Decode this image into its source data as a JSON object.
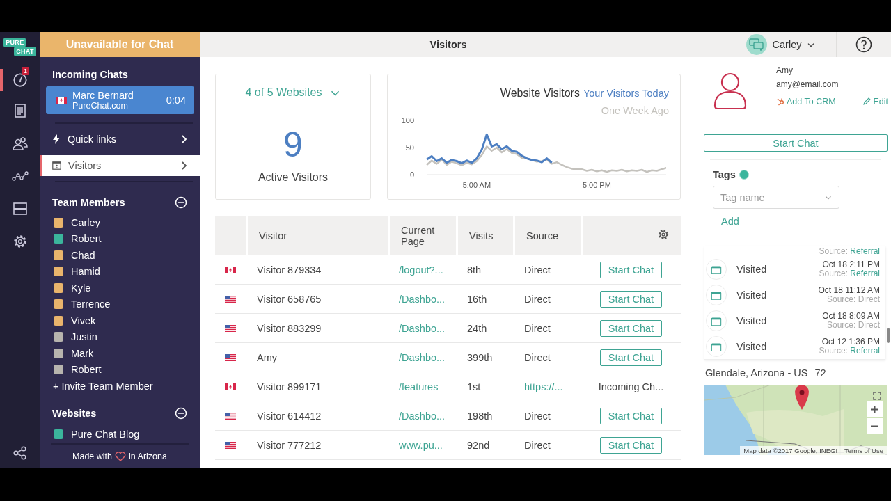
{
  "rail": {
    "logo": [
      "PURE",
      "CHAT"
    ],
    "badge": "1"
  },
  "sidebar": {
    "status": "Unavailable for Chat",
    "incoming_title": "Incoming Chats",
    "chats": [
      {
        "kind": "ca",
        "name": "Marc Bernard",
        "site": "PureChat.com",
        "time": "0:04"
      }
    ],
    "nav": [
      {
        "kind": "bolt",
        "label": "Quick links",
        "selected": false
      },
      {
        "kind": "browser",
        "label": "Visitors",
        "selected": true
      }
    ],
    "team_title": "Team Members",
    "team": [
      {
        "name": "Carley",
        "color": "#e9b46c"
      },
      {
        "name": "Robert",
        "color": "#3bb59c"
      },
      {
        "name": "Chad",
        "color": "#e9b46c"
      },
      {
        "name": "Hamid",
        "color": "#e9b46c"
      },
      {
        "name": "Kyle",
        "color": "#e9b46c"
      },
      {
        "name": "Terrence",
        "color": "#e9b46c"
      },
      {
        "name": "Vivek",
        "color": "#e9b46c"
      },
      {
        "name": "Justin",
        "color": "#b7b4ae"
      },
      {
        "name": "Mark",
        "color": "#b7b4ae"
      },
      {
        "name": "Robert",
        "color": "#b7b4ae"
      }
    ],
    "invite": "+ Invite Team Member",
    "websites_title": "Websites",
    "websites": [
      {
        "name": "Pure Chat Blog",
        "color": "#3bb59c"
      }
    ],
    "footer": [
      "Made with",
      "in Arizona"
    ]
  },
  "topbar": {
    "title": "Visitors",
    "user": "Carley"
  },
  "summary": {
    "websites": "4 of 5 Websites",
    "count": "9",
    "label": "Active Visitors"
  },
  "chart": {
    "chart_data": {
      "type": "line",
      "title": "Website Visitors",
      "x": [
        0,
        0.5,
        1,
        1.5,
        2,
        2.5,
        3,
        3.5,
        4,
        4.5,
        5,
        5.5,
        6,
        6.5,
        7,
        7.5,
        8,
        8.5,
        9,
        9.5,
        10,
        10.5,
        11,
        11.5,
        12,
        12.5,
        13,
        13.5,
        14,
        14.5,
        15,
        15.5,
        16,
        16.5,
        17,
        17.5,
        18,
        18.5,
        19,
        19.5,
        20,
        20.5,
        21,
        21.5,
        22,
        22.5,
        23,
        23.5,
        24
      ],
      "xlim": [
        0,
        24
      ],
      "ylim": [
        0,
        100
      ],
      "yticks": [
        0,
        50,
        100
      ],
      "xticks": [
        {
          "value": 5,
          "label": "5:00 AM"
        },
        {
          "value": 17,
          "label": "5:00 PM"
        }
      ],
      "series": [
        {
          "name": "Your Visitors Today",
          "color": "#4d7fc2",
          "values": [
            28,
            34,
            25,
            30,
            22,
            27,
            25,
            21,
            26,
            22,
            30,
            46,
            74,
            52,
            56,
            47,
            52,
            44,
            42,
            35,
            30,
            27,
            26,
            23,
            30,
            22,
            null,
            null,
            null,
            null,
            null,
            null,
            null,
            null,
            null,
            null,
            null,
            null,
            null,
            null,
            null,
            null,
            null,
            null,
            null,
            null,
            null,
            null,
            null
          ]
        },
        {
          "name": "One Week Ago",
          "color": "#c4c2bd",
          "values": [
            18,
            26,
            20,
            28,
            18,
            24,
            21,
            17,
            22,
            19,
            25,
            36,
            52,
            44,
            50,
            41,
            47,
            40,
            38,
            31,
            30,
            27,
            24,
            25,
            28,
            20,
            23,
            18,
            14,
            11,
            10,
            10,
            7,
            9,
            6,
            8,
            5,
            8,
            7,
            9,
            6,
            8,
            7,
            9,
            5,
            8,
            7,
            10,
            13
          ]
        }
      ]
    }
  },
  "table": {
    "columns": [
      "Visitor",
      "Current Page",
      "Visits",
      "Source"
    ],
    "rows": [
      {
        "kind": "ca",
        "visitor": "Visitor 879334",
        "page": "/logout?...",
        "visits": "8th",
        "source": "Direct",
        "source_link": false,
        "action": {
          "kind": "button",
          "label": "Start Chat"
        }
      },
      {
        "kind": "us",
        "visitor": "Visitor 658765",
        "page": "/Dashbo...",
        "visits": "16th",
        "source": "Direct",
        "source_link": false,
        "action": {
          "kind": "button",
          "label": "Start Chat"
        }
      },
      {
        "kind": "us",
        "visitor": "Visitor 883299",
        "page": "/Dashbo...",
        "visits": "24th",
        "source": "Direct",
        "source_link": false,
        "action": {
          "kind": "button",
          "label": "Start Chat"
        }
      },
      {
        "kind": "us",
        "visitor": "Amy",
        "page": "/Dashbo...",
        "visits": "399th",
        "source": "Direct",
        "source_link": false,
        "action": {
          "kind": "button",
          "label": "Start Chat"
        }
      },
      {
        "kind": "ca",
        "visitor": "Visitor 899171",
        "page": "/features",
        "visits": "1st",
        "source": "https://...",
        "source_link": true,
        "action": {
          "kind": "status",
          "label": "Incoming Ch..."
        }
      },
      {
        "kind": "us",
        "visitor": "Visitor 614412",
        "page": "/Dashbo...",
        "visits": "198th",
        "source": "Direct",
        "source_link": false,
        "action": {
          "kind": "button",
          "label": "Start Chat"
        }
      },
      {
        "kind": "us",
        "visitor": "Visitor 777212",
        "page": "www.pu...",
        "visits": "92nd",
        "source": "Direct",
        "source_link": false,
        "action": {
          "kind": "button",
          "label": "Start Chat"
        }
      }
    ]
  },
  "details": {
    "name": "Amy",
    "email": "amy@email.com",
    "crm": "Add To CRM",
    "edit": "Edit",
    "start": "Start Chat",
    "tags_title": "Tags",
    "tag_placeholder": "Tag name",
    "add": "Add",
    "activity": [
      {
        "source_label": "Source:",
        "source": "Referral",
        "linked": true
      },
      {
        "action": "Visited",
        "time": "Oct 18 2:11 PM",
        "source_label": "Source:",
        "source": "Referral",
        "linked": true
      },
      {
        "action": "Visited",
        "time": "Oct 18 11:12 AM",
        "source_label": "Source:",
        "source": "Direct",
        "linked": false
      },
      {
        "action": "Visited",
        "time": "Oct 18 8:09 AM",
        "source_label": "Source:",
        "source": "Direct",
        "linked": false
      },
      {
        "action": "Visited",
        "time": "Oct 12 1:36 PM",
        "source_label": "Source:",
        "source": "Referral",
        "linked": true
      }
    ],
    "location": "Glendale, Arizona - US",
    "location_code": "72",
    "map": {
      "kind": "picture",
      "attribution": "Map data ©2017 Google, INEGI",
      "terms": "Terms of Use"
    }
  }
}
